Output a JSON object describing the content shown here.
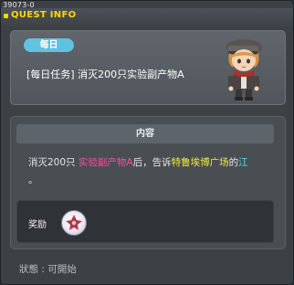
{
  "window": {
    "id_label": "39073-0",
    "title": "QUEST INFO"
  },
  "quest": {
    "badge": "每日",
    "name": "[每日任务] 消灭200只实验副产物A",
    "npc_icon": "npc-portrait"
  },
  "content": {
    "header": "内容",
    "text_parts": {
      "p1": "消灭200只 ",
      "p2": "实验副产物A",
      "p3": "后，告诉",
      "p4": "特鲁埃博广场",
      "p5": "的",
      "p6": "江",
      "p7": "。"
    }
  },
  "reward": {
    "label": "奖励",
    "icon": "exp-reward-icon"
  },
  "status": {
    "text": "狀態 : 可開始"
  },
  "colors": {
    "title": "#ffd800",
    "badge": "#61c1e1",
    "highlight_item": "#ff4aa3",
    "highlight_place": "#f5ee3e",
    "highlight_npc": "#57e0f2"
  }
}
